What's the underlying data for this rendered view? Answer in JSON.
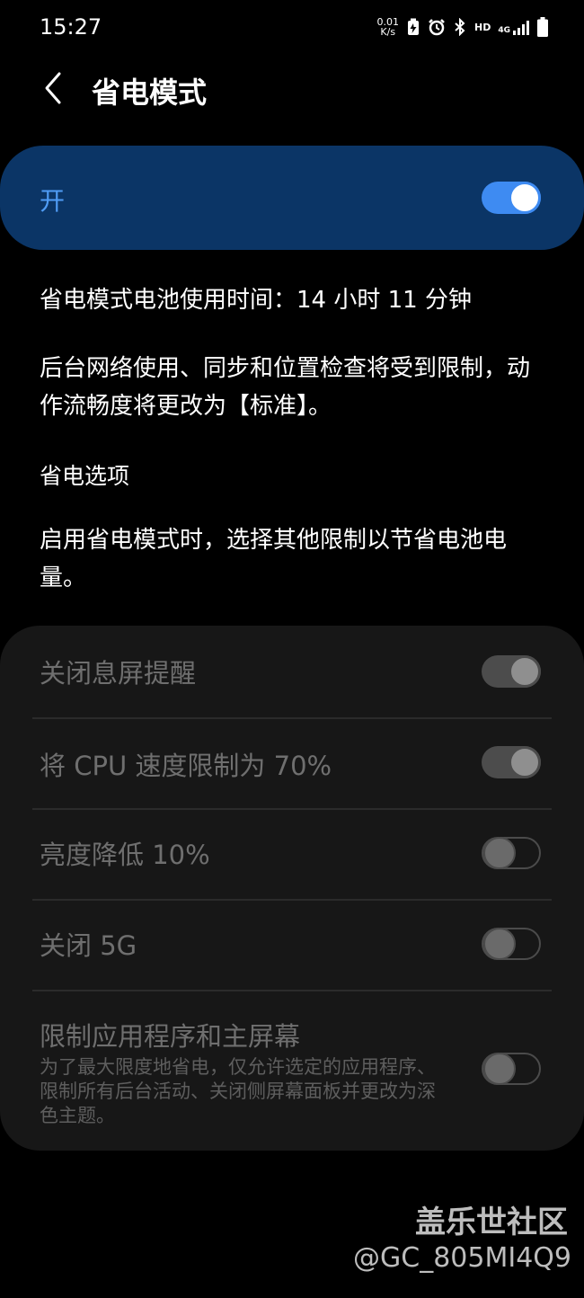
{
  "status_bar": {
    "time": "15:27",
    "net_speed_value": "0.01",
    "net_speed_unit": "K/s",
    "hd_label": "HD",
    "net_type": "4G",
    "icons": [
      "battery-saver-icon",
      "alarm-icon",
      "bluetooth-icon",
      "hd-voice-icon",
      "signal-icon",
      "battery-icon"
    ]
  },
  "header": {
    "title": "省电模式"
  },
  "master": {
    "label": "开",
    "state": "on",
    "accent_color": "#3e8bf2",
    "panel_color": "#0b3566"
  },
  "info": {
    "remaining": "省电模式电池使用时间：14 小时 11 分钟",
    "description": "后台网络使用、同步和位置检查将受到限制，动作流畅度将更改为【标准】。"
  },
  "options_section": {
    "title": "省电选项",
    "description": "启用省电模式时，选择其他限制以节省电池电量。"
  },
  "options": [
    {
      "label": "关闭息屏提醒",
      "state": "on"
    },
    {
      "label": "将 CPU 速度限制为 70%",
      "state": "on"
    },
    {
      "label": "亮度降低 10%",
      "state": "off"
    },
    {
      "label": "关闭 5G",
      "state": "off"
    },
    {
      "label": "限制应用程序和主屏幕",
      "sublabel": "为了最大限度地省电，仅允许选定的应用程序、限制所有后台活动、关闭侧屏幕面板并更改为深色主题。",
      "state": "off"
    }
  ],
  "watermark": {
    "brand": "盖乐世社区",
    "user": "@GC_805MI4Q9"
  }
}
